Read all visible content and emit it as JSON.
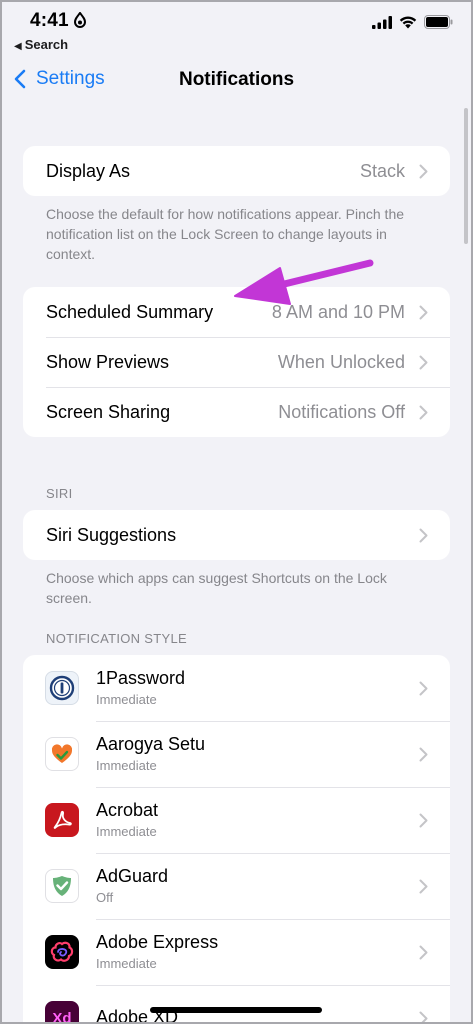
{
  "status_bar": {
    "time": "4:41",
    "back_app": "Search"
  },
  "nav": {
    "back_label": "Settings",
    "title": "Notifications"
  },
  "display_group": {
    "rows": [
      {
        "label": "Display As",
        "value": "Stack"
      }
    ],
    "footer": "Choose the default for how notifications appear. Pinch the notification list on the Lock Screen to change layouts in context."
  },
  "summary_group": {
    "rows": [
      {
        "label": "Scheduled Summary",
        "value": "8 AM and 10 PM"
      },
      {
        "label": "Show Previews",
        "value": "When Unlocked"
      },
      {
        "label": "Screen Sharing",
        "value": "Notifications Off"
      }
    ]
  },
  "siri": {
    "header": "SIRI",
    "row_label": "Siri Suggestions",
    "footer": "Choose which apps can suggest Shortcuts on the Lock screen."
  },
  "notification_style": {
    "header": "NOTIFICATION STYLE",
    "apps": [
      {
        "name": "1Password",
        "status": "Immediate",
        "icon": "1password-icon"
      },
      {
        "name": "Aarogya Setu",
        "status": "Immediate",
        "icon": "aarogya-setu-icon"
      },
      {
        "name": "Acrobat",
        "status": "Immediate",
        "icon": "acrobat-icon"
      },
      {
        "name": "AdGuard",
        "status": "Off",
        "icon": "adguard-icon"
      },
      {
        "name": "Adobe Express",
        "status": "Immediate",
        "icon": "adobe-express-icon"
      },
      {
        "name": "Adobe XD",
        "status": "",
        "icon": "adobe-xd-icon"
      }
    ]
  },
  "colors": {
    "accent": "#1a7cf5",
    "background": "#f2f2f7",
    "annotation_arrow": "#c236d6"
  }
}
